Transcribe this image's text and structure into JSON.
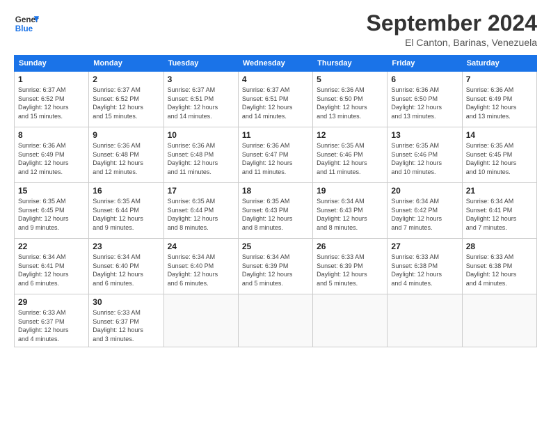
{
  "header": {
    "logo_line1": "General",
    "logo_line2": "Blue",
    "month_title": "September 2024",
    "subtitle": "El Canton, Barinas, Venezuela"
  },
  "days_of_week": [
    "Sunday",
    "Monday",
    "Tuesday",
    "Wednesday",
    "Thursday",
    "Friday",
    "Saturday"
  ],
  "weeks": [
    [
      {
        "day": "1",
        "info": "Sunrise: 6:37 AM\nSunset: 6:52 PM\nDaylight: 12 hours\nand 15 minutes."
      },
      {
        "day": "2",
        "info": "Sunrise: 6:37 AM\nSunset: 6:52 PM\nDaylight: 12 hours\nand 15 minutes."
      },
      {
        "day": "3",
        "info": "Sunrise: 6:37 AM\nSunset: 6:51 PM\nDaylight: 12 hours\nand 14 minutes."
      },
      {
        "day": "4",
        "info": "Sunrise: 6:37 AM\nSunset: 6:51 PM\nDaylight: 12 hours\nand 14 minutes."
      },
      {
        "day": "5",
        "info": "Sunrise: 6:36 AM\nSunset: 6:50 PM\nDaylight: 12 hours\nand 13 minutes."
      },
      {
        "day": "6",
        "info": "Sunrise: 6:36 AM\nSunset: 6:50 PM\nDaylight: 12 hours\nand 13 minutes."
      },
      {
        "day": "7",
        "info": "Sunrise: 6:36 AM\nSunset: 6:49 PM\nDaylight: 12 hours\nand 13 minutes."
      }
    ],
    [
      {
        "day": "8",
        "info": "Sunrise: 6:36 AM\nSunset: 6:49 PM\nDaylight: 12 hours\nand 12 minutes."
      },
      {
        "day": "9",
        "info": "Sunrise: 6:36 AM\nSunset: 6:48 PM\nDaylight: 12 hours\nand 12 minutes."
      },
      {
        "day": "10",
        "info": "Sunrise: 6:36 AM\nSunset: 6:48 PM\nDaylight: 12 hours\nand 11 minutes."
      },
      {
        "day": "11",
        "info": "Sunrise: 6:36 AM\nSunset: 6:47 PM\nDaylight: 12 hours\nand 11 minutes."
      },
      {
        "day": "12",
        "info": "Sunrise: 6:35 AM\nSunset: 6:46 PM\nDaylight: 12 hours\nand 11 minutes."
      },
      {
        "day": "13",
        "info": "Sunrise: 6:35 AM\nSunset: 6:46 PM\nDaylight: 12 hours\nand 10 minutes."
      },
      {
        "day": "14",
        "info": "Sunrise: 6:35 AM\nSunset: 6:45 PM\nDaylight: 12 hours\nand 10 minutes."
      }
    ],
    [
      {
        "day": "15",
        "info": "Sunrise: 6:35 AM\nSunset: 6:45 PM\nDaylight: 12 hours\nand 9 minutes."
      },
      {
        "day": "16",
        "info": "Sunrise: 6:35 AM\nSunset: 6:44 PM\nDaylight: 12 hours\nand 9 minutes."
      },
      {
        "day": "17",
        "info": "Sunrise: 6:35 AM\nSunset: 6:44 PM\nDaylight: 12 hours\nand 8 minutes."
      },
      {
        "day": "18",
        "info": "Sunrise: 6:35 AM\nSunset: 6:43 PM\nDaylight: 12 hours\nand 8 minutes."
      },
      {
        "day": "19",
        "info": "Sunrise: 6:34 AM\nSunset: 6:43 PM\nDaylight: 12 hours\nand 8 minutes."
      },
      {
        "day": "20",
        "info": "Sunrise: 6:34 AM\nSunset: 6:42 PM\nDaylight: 12 hours\nand 7 minutes."
      },
      {
        "day": "21",
        "info": "Sunrise: 6:34 AM\nSunset: 6:41 PM\nDaylight: 12 hours\nand 7 minutes."
      }
    ],
    [
      {
        "day": "22",
        "info": "Sunrise: 6:34 AM\nSunset: 6:41 PM\nDaylight: 12 hours\nand 6 minutes."
      },
      {
        "day": "23",
        "info": "Sunrise: 6:34 AM\nSunset: 6:40 PM\nDaylight: 12 hours\nand 6 minutes."
      },
      {
        "day": "24",
        "info": "Sunrise: 6:34 AM\nSunset: 6:40 PM\nDaylight: 12 hours\nand 6 minutes."
      },
      {
        "day": "25",
        "info": "Sunrise: 6:34 AM\nSunset: 6:39 PM\nDaylight: 12 hours\nand 5 minutes."
      },
      {
        "day": "26",
        "info": "Sunrise: 6:33 AM\nSunset: 6:39 PM\nDaylight: 12 hours\nand 5 minutes."
      },
      {
        "day": "27",
        "info": "Sunrise: 6:33 AM\nSunset: 6:38 PM\nDaylight: 12 hours\nand 4 minutes."
      },
      {
        "day": "28",
        "info": "Sunrise: 6:33 AM\nSunset: 6:38 PM\nDaylight: 12 hours\nand 4 minutes."
      }
    ],
    [
      {
        "day": "29",
        "info": "Sunrise: 6:33 AM\nSunset: 6:37 PM\nDaylight: 12 hours\nand 4 minutes."
      },
      {
        "day": "30",
        "info": "Sunrise: 6:33 AM\nSunset: 6:37 PM\nDaylight: 12 hours\nand 3 minutes."
      },
      {
        "day": "",
        "info": ""
      },
      {
        "day": "",
        "info": ""
      },
      {
        "day": "",
        "info": ""
      },
      {
        "day": "",
        "info": ""
      },
      {
        "day": "",
        "info": ""
      }
    ]
  ]
}
